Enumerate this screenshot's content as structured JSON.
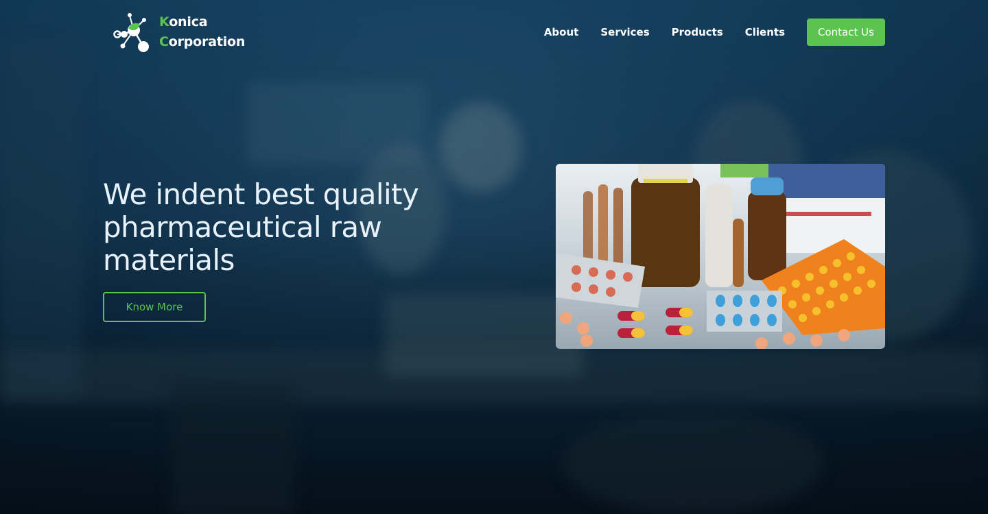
{
  "brand": {
    "line1_initial": "K",
    "line1_rest": "onica",
    "line2_initial": "C",
    "line2_rest": "orporation",
    "logo_icon": "molecule-leaf-icon",
    "accent_color": "#5bc44e"
  },
  "nav": {
    "items": [
      {
        "label": "About"
      },
      {
        "label": "Services"
      },
      {
        "label": "Products"
      },
      {
        "label": "Clients"
      }
    ],
    "cta_label": "Contact Us"
  },
  "hero": {
    "title": "We indent best quality pharmaceutical raw materials",
    "button_label": "Know More",
    "image": "pharmaceutical-pills-photo"
  },
  "colors": {
    "background": "#0b2233",
    "headline": "#e8f2fb",
    "accent": "#5bc44e"
  }
}
